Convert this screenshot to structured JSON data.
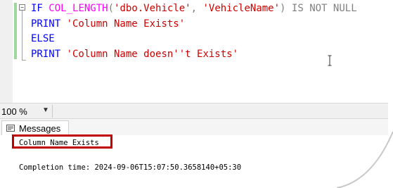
{
  "editor": {
    "lines": [
      {
        "segments": [
          {
            "text": "IF ",
            "cls": "kw"
          },
          {
            "text": "COL_LENGTH",
            "cls": "fn"
          },
          {
            "text": "(",
            "cls": "op"
          },
          {
            "text": "'dbo.Vehicle'",
            "cls": "str"
          },
          {
            "text": ", ",
            "cls": "op"
          },
          {
            "text": "'VehicleName'",
            "cls": "str"
          },
          {
            "text": ") ",
            "cls": "op"
          },
          {
            "text": "IS NOT NULL",
            "cls": "op"
          }
        ]
      },
      {
        "segments": [
          {
            "text": "PRINT ",
            "cls": "kw"
          },
          {
            "text": "'Column Name Exists'",
            "cls": "str"
          }
        ]
      },
      {
        "segments": [
          {
            "text": "ELSE",
            "cls": "kw"
          }
        ]
      },
      {
        "segments": [
          {
            "text": "PRINT ",
            "cls": "kw"
          },
          {
            "text": "'Column Name doesn''t Exists'",
            "cls": "str"
          }
        ]
      }
    ],
    "fold_symbol": "−"
  },
  "zoom": {
    "value": "100 %",
    "arrow": "▼"
  },
  "messages_tab": {
    "label": "Messages"
  },
  "results": {
    "line1": "Column Name Exists",
    "line2": "Completion time: 2024-09-06T15:07:50.3658140+05:30"
  },
  "colors": {
    "keyword": "#0000ff",
    "function": "#ff00ff",
    "string": "#cc0000",
    "operator": "#808080",
    "highlight_border": "#c00000"
  }
}
